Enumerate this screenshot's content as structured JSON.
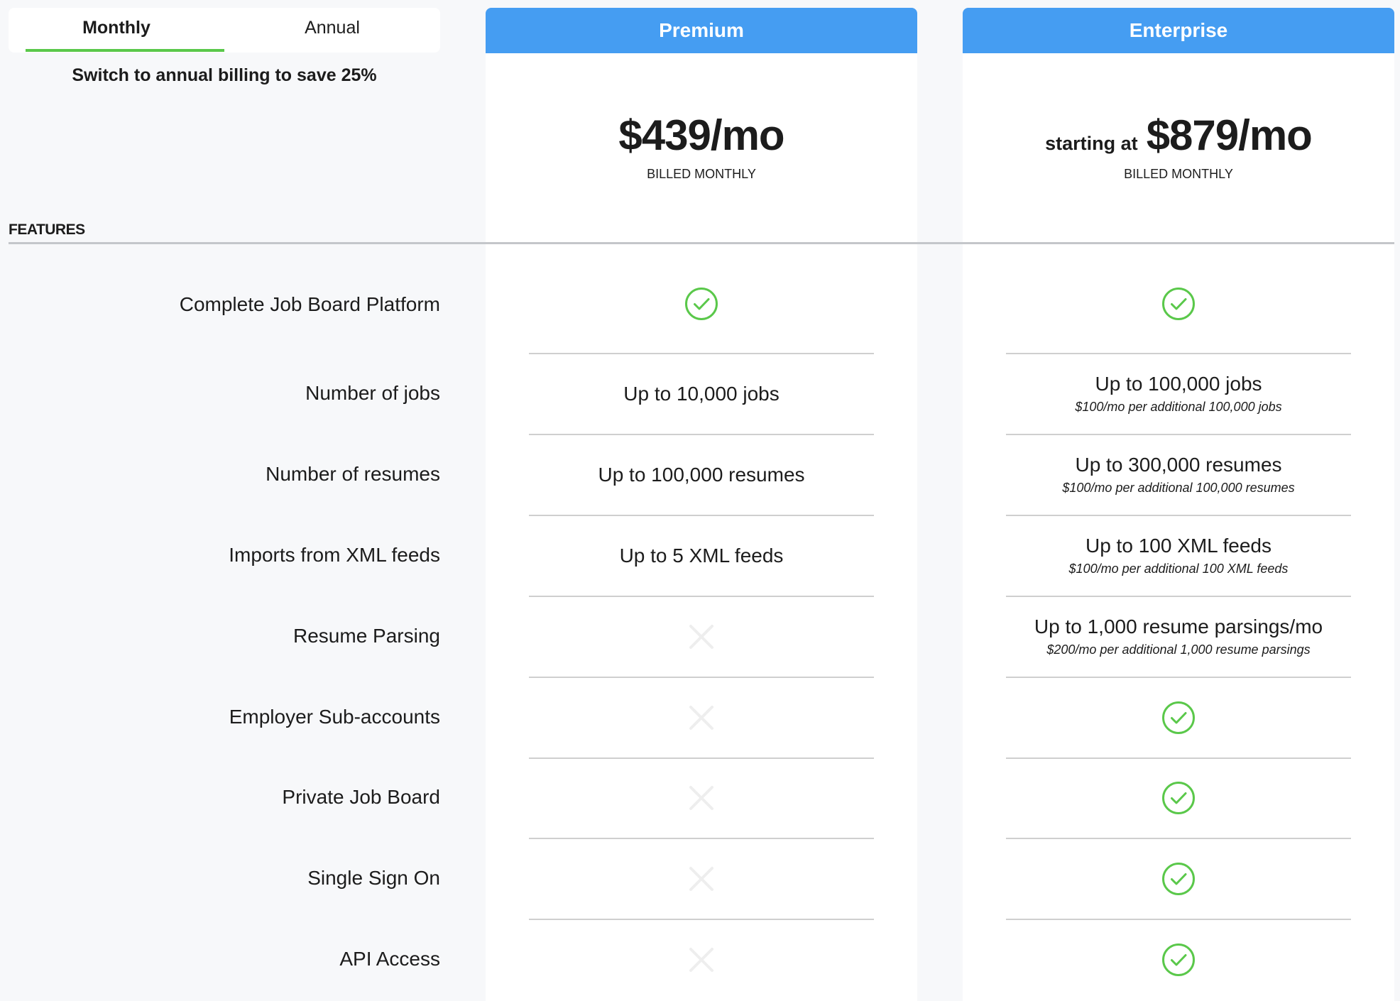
{
  "billing": {
    "tabs": [
      {
        "label": "Monthly",
        "active": true
      },
      {
        "label": "Annual",
        "active": false
      }
    ],
    "save_note": "Switch to annual billing to save 25%",
    "accent_color": "#5ac84a"
  },
  "features_heading": "FEATURES",
  "plans": [
    {
      "name": "Premium",
      "price_prefix": "",
      "price": "$439/mo",
      "billed": "BILLED MONTHLY",
      "header_color": "#459df2"
    },
    {
      "name": "Enterprise",
      "price_prefix": "starting at",
      "price": "$879/mo",
      "billed": "BILLED MONTHLY",
      "header_color": "#459df2"
    }
  ],
  "features": [
    {
      "label": "Complete Job Board Platform",
      "premium": {
        "type": "check-icon"
      },
      "enterprise": {
        "type": "check-icon"
      }
    },
    {
      "label": "Number of jobs",
      "premium": {
        "type": "text",
        "main": "Up to 10,000 jobs",
        "sub": ""
      },
      "enterprise": {
        "type": "text",
        "main": "Up to 100,000 jobs",
        "sub": "$100/mo per additional 100,000 jobs"
      }
    },
    {
      "label": "Number of resumes",
      "premium": {
        "type": "text",
        "main": "Up to 100,000 resumes",
        "sub": ""
      },
      "enterprise": {
        "type": "text",
        "main": "Up to 300,000 resumes",
        "sub": "$100/mo per additional 100,000 resumes"
      }
    },
    {
      "label": "Imports from XML feeds",
      "premium": {
        "type": "text",
        "main": "Up to 5 XML feeds",
        "sub": ""
      },
      "enterprise": {
        "type": "text",
        "main": "Up to 100 XML feeds",
        "sub": "$100/mo per additional 100 XML feeds"
      }
    },
    {
      "label": "Resume Parsing",
      "premium": {
        "type": "x-icon"
      },
      "enterprise": {
        "type": "text",
        "main": "Up to 1,000 resume parsings/mo",
        "sub": "$200/mo per additional 1,000 resume parsings"
      }
    },
    {
      "label": "Employer Sub-accounts",
      "premium": {
        "type": "x-icon"
      },
      "enterprise": {
        "type": "check-icon"
      }
    },
    {
      "label": "Private Job Board",
      "premium": {
        "type": "x-icon"
      },
      "enterprise": {
        "type": "check-icon"
      }
    },
    {
      "label": "Single Sign On",
      "premium": {
        "type": "x-icon"
      },
      "enterprise": {
        "type": "check-icon"
      }
    },
    {
      "label": "API Access",
      "premium": {
        "type": "x-icon"
      },
      "enterprise": {
        "type": "check-icon"
      }
    }
  ],
  "colors": {
    "check": "#5ac84a",
    "x": "#eeeeee",
    "background": "#f7f8fa"
  }
}
